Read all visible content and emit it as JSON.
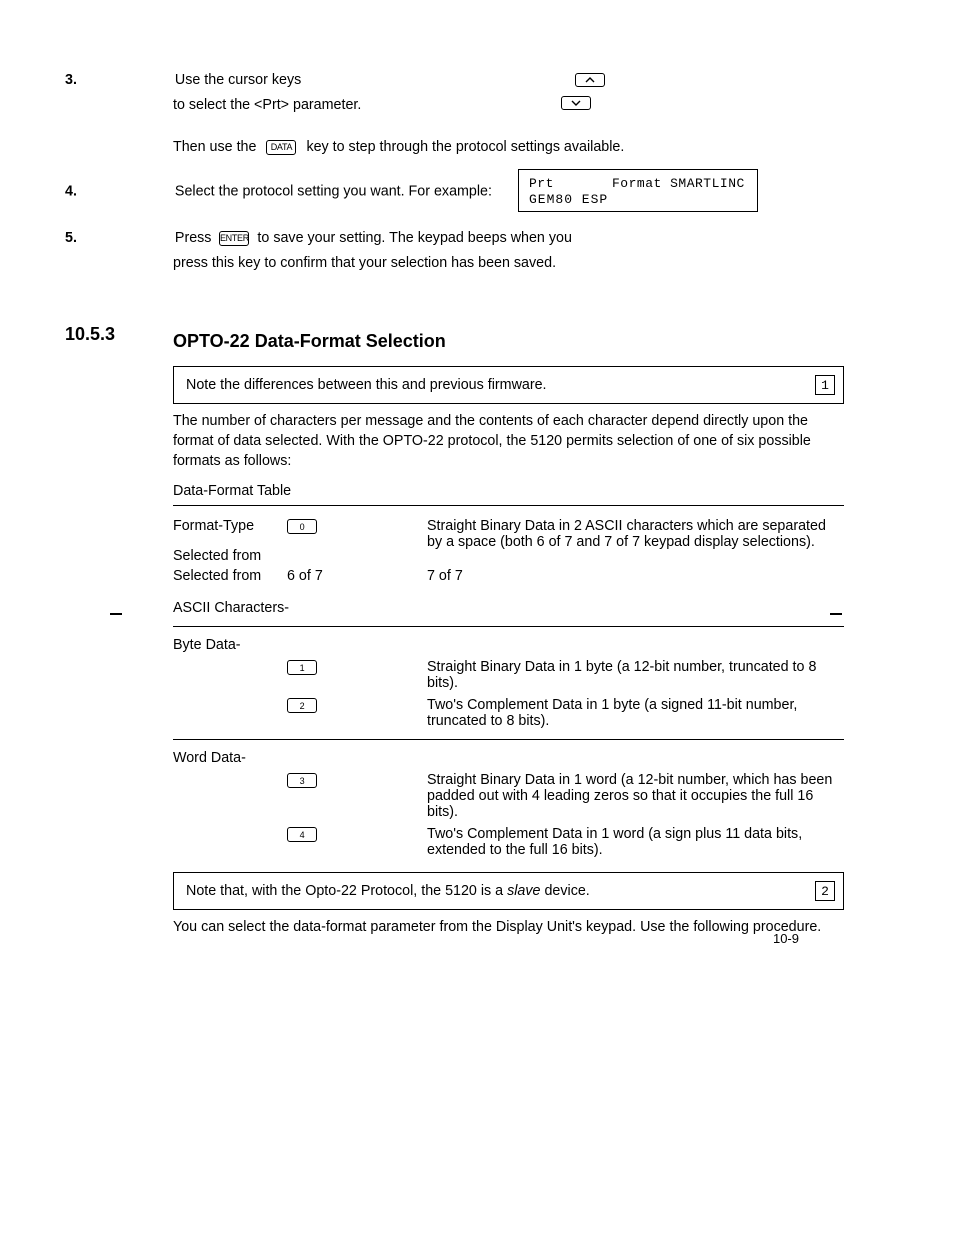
{
  "step3": {
    "label": "3.",
    "text_a": "Use the cursor keys",
    "text_b": "to select the <Prt> parameter.",
    "text_c": "Then use the",
    "text_d": "key to step through the protocol settings available.",
    "key": "DATA",
    "cursor_up_icon": "chevron-up",
    "cursor_down_icon": "chevron-down"
  },
  "step4": {
    "label": "4.",
    "text": "Select the protocol setting you want. For example:",
    "lcd_line1": "Prt       Format SMARTLINC",
    "lcd_line2": "GEM80 ESP"
  },
  "step5": {
    "label": "5.",
    "text_a": "Press",
    "text_b": "to save your setting. The keypad beeps when you",
    "text_c": "press this key to confirm that your selection has been saved.",
    "key": "ENTER"
  },
  "section10_5_3": {
    "label": "10.5.3",
    "title": "OPTO-22 Data-Format Selection"
  },
  "note1": {
    "text": "Note the differences between this and previous firmware.",
    "num": "1"
  },
  "para1": "The number of characters per message and the contents of each character depend directly upon the format of data selected. With the OPTO-22 protocol, the 5120 permits selection of one of six possible formats as follows:",
  "table": {
    "title": "Data-Format Table",
    "head_labels": [
      "Format-Type",
      "Selected from",
      "Selected from"
    ],
    "head_vals": [
      "",
      "6 of 7",
      "7 of 7"
    ],
    "rows": [
      {
        "section": "ASCII Characters-",
        "items": [
          {
            "key": "0",
            "desc": "Straight Binary Data in 2 ASCII characters which are separated by a space (both 6 of 7 and 7 of 7 keypad display selections)."
          }
        ]
      },
      {
        "section": "Byte Data-",
        "items": [
          {
            "key": "1",
            "desc": "Straight Binary Data in 1 byte (a 12-bit number, truncated to 8 bits)."
          },
          {
            "key": "2",
            "desc": "Two's Complement Data in 1 byte (a signed 11-bit number, truncated to 8 bits)."
          }
        ]
      },
      {
        "section": "Word Data-",
        "items": [
          {
            "key": "3",
            "desc": "Straight Binary Data in 1 word (a 12-bit number, which has been padded out with 4 leading zeros so that it occupies the full 16 bits)."
          },
          {
            "key": "4",
            "desc": "Two's Complement Data in 1 word (a sign plus 11 data bits, extended to the full 16 bits)."
          }
        ]
      }
    ]
  },
  "note2": {
    "text": "Note that, with the Opto-22 Protocol, the 5120 is a",
    "em": "slave",
    "tail": "device.",
    "num": "2"
  },
  "para2": "You can select the data-format parameter from the Display Unit's keypad. Use the following procedure.",
  "page_number": "10-9"
}
